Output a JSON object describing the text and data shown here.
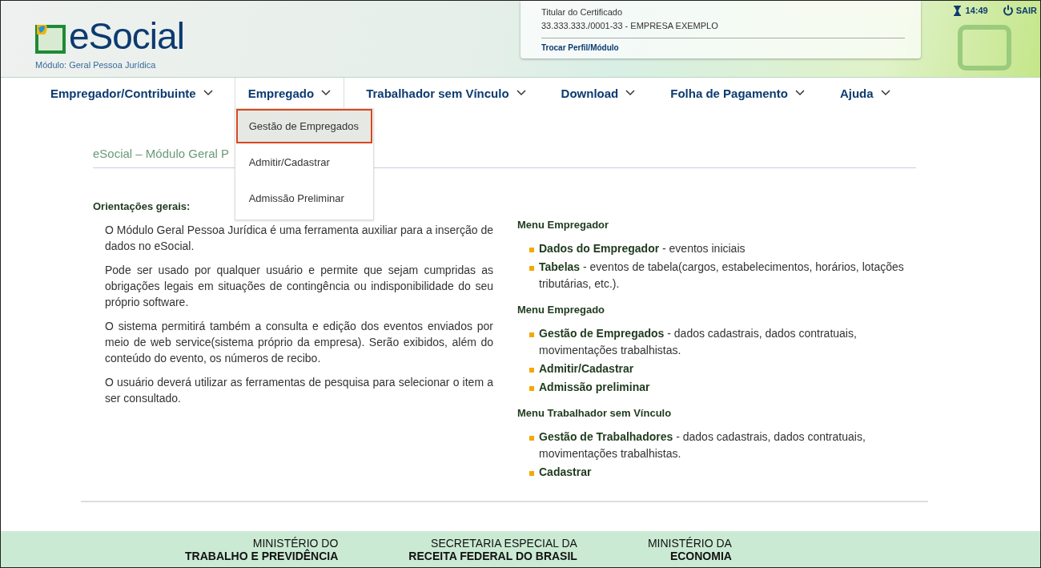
{
  "header": {
    "logo": "eSocial",
    "module": "Módulo: Geral Pessoa Jurídica",
    "certificate": {
      "label": "Titular do Certificado",
      "value": "33.333.333./0001-33 - EMPRESA EXEMPLO",
      "link": "Trocar Perfil/Módulo"
    },
    "time": "14:49",
    "logout": "SAIR"
  },
  "nav": [
    {
      "label": "Empregador/Contribuinte",
      "selected": false
    },
    {
      "label": "Empregado",
      "selected": true
    },
    {
      "label": "Trabalhador sem Vínculo",
      "selected": false
    },
    {
      "label": "Download",
      "selected": false
    },
    {
      "label": "Folha de Pagamento",
      "selected": false
    },
    {
      "label": "Ajuda",
      "selected": false
    }
  ],
  "dropdown": [
    {
      "label": "Gestão de Empregados",
      "selected": true
    },
    {
      "label": "Admitir/Cadastrar",
      "selected": false
    },
    {
      "label": "Admissão Preliminar",
      "selected": false
    }
  ],
  "page_title": "eSocial – Módulo Geral P",
  "guidelines": {
    "heading": "Orientações gerais:",
    "paragraphs": [
      "O Módulo Geral Pessoa Jurídica é uma ferramenta auxiliar para a inserção de dados no eSocial.",
      "Pode ser usado por qualquer usuário e permite que sejam cumpridas as obrigações legais em situações de contingência ou indisponibilidade do seu próprio software.",
      "O sistema permitirá também a consulta e edição dos eventos enviados por meio de web service(sistema próprio da empresa). Serão exibidos, além do conteúdo do evento, os números de recibo.",
      "O usuário deverá utilizar as ferramentas de pesquisa para selecionar o item a ser consultado."
    ]
  },
  "menus": [
    {
      "heading": "Menu Empregador",
      "items": [
        "**Dados do Empregador** - eventos iniciais",
        "**Tabelas** - eventos de tabela(cargos, estabelecimentos, horários, lotações tributárias, etc.)."
      ]
    },
    {
      "heading": "Menu Empregado",
      "items": [
        "**Gestão de Empregados** - dados cadastrais, dados contratuais, movimentações trabalhistas.",
        "**Admitir/Cadastrar**",
        "**Admissão preliminar**"
      ]
    },
    {
      "heading": "Menu Trabalhador sem Vínculo",
      "items": [
        "**Gestão de Trabalhadores** - dados cadastrais, dados contratuais, movimentações trabalhistas.",
        "**Cadastrar**"
      ]
    }
  ],
  "footer": [
    {
      "top": "MINISTÉRIO DO",
      "bottom": "TRABALHO E PREVIDÊNCIA"
    },
    {
      "top": "SECRETARIA ESPECIAL DA",
      "bottom": "RECEITA FEDERAL DO BRASIL"
    },
    {
      "top": "MINISTÉRIO DA",
      "bottom": "ECONOMIA"
    }
  ]
}
